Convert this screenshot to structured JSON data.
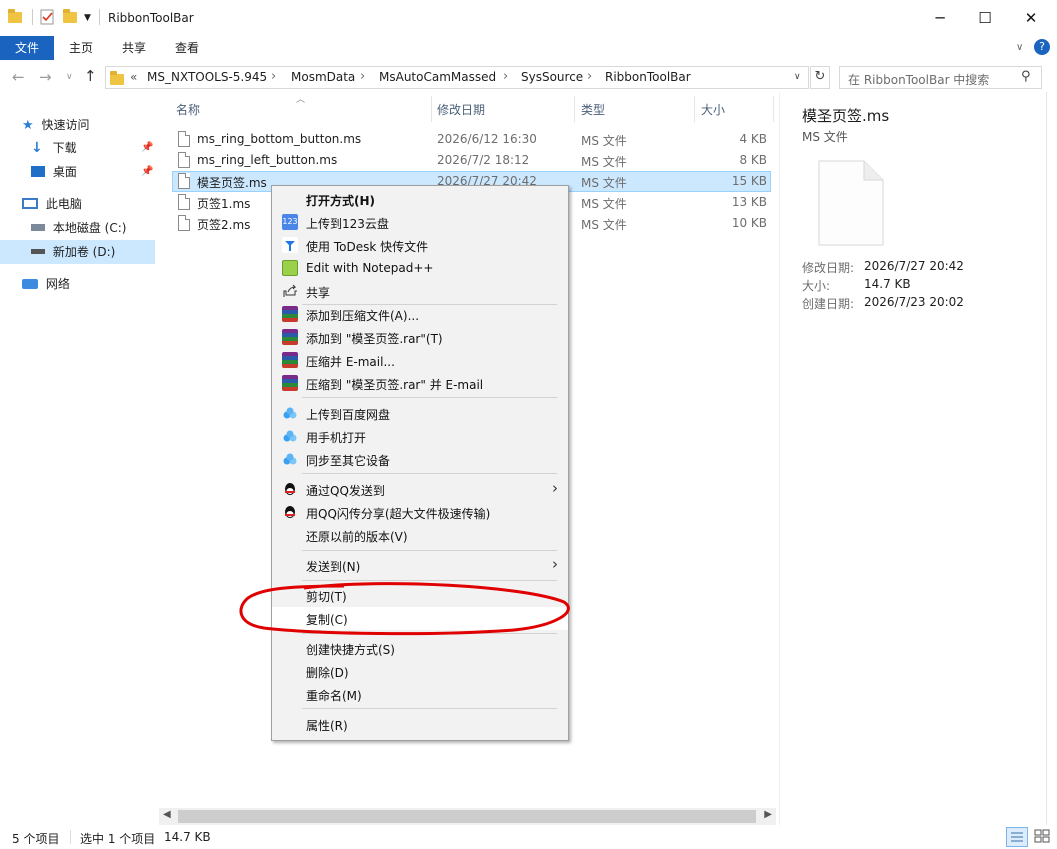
{
  "window": {
    "title": "RibbonToolBar",
    "minimize": "─",
    "maximize": "☐",
    "close": "✕"
  },
  "ribbon": {
    "tabs": [
      "文件",
      "主页",
      "共享",
      "查看"
    ],
    "help": "?"
  },
  "address": {
    "overflow": "«",
    "crumbs": [
      "MS_NXTOOLS-5.945",
      "MosmData",
      "MsAutoCamMassed",
      "SysSource",
      "RibbonToolBar"
    ],
    "search_placeholder": "在 RibbonToolBar 中搜索"
  },
  "nav": {
    "items": [
      "快速访问",
      "下载",
      "桌面",
      "此电脑",
      "本地磁盘 (C:)",
      "新加卷 (D:)",
      "网络"
    ]
  },
  "list": {
    "headers": {
      "name": "名称",
      "date": "修改日期",
      "type": "类型",
      "size": "大小"
    },
    "rows": [
      {
        "name": "ms_ring_bottom_button.ms",
        "date": "2026/6/12 16:30",
        "type": "MS 文件",
        "size": "4 KB"
      },
      {
        "name": "ms_ring_left_button.ms",
        "date": "2026/7/2 18:12",
        "type": "MS 文件",
        "size": "8 KB"
      },
      {
        "name": "模圣页签.ms",
        "date": "2026/7/27 20:42",
        "type": "MS 文件",
        "size": "15 KB"
      },
      {
        "name": "页签1.ms",
        "date": "",
        "type": "MS 文件",
        "size": "13 KB"
      },
      {
        "name": "页签2.ms",
        "date": "",
        "type": "MS 文件",
        "size": "10 KB"
      }
    ]
  },
  "context_menu": {
    "items": [
      "打开方式(H)",
      "上传到123云盘",
      "使用 ToDesk 快传文件",
      "Edit with Notepad++",
      "共享",
      "添加到压缩文件(A)...",
      "添加到 \"模圣页签.rar\"(T)",
      "压缩并 E-mail...",
      "压缩到 \"模圣页签.rar\" 并 E-mail",
      "上传到百度网盘",
      "用手机打开",
      "同步至其它设备",
      "通过QQ发送到",
      "用QQ闪传分享(超大文件极速传输)",
      "还原以前的版本(V)",
      "发送到(N)",
      "剪切(T)",
      "复制(C)",
      "创建快捷方式(S)",
      "删除(D)",
      "重命名(M)",
      "属性(R)"
    ],
    "icon_123": "123"
  },
  "details": {
    "filename": "模圣页签.ms",
    "filetype": "MS 文件",
    "labels": [
      "修改日期:",
      "大小:",
      "创建日期:"
    ],
    "values": [
      "2026/7/27 20:42",
      "14.7 KB",
      "2026/7/23 20:02"
    ]
  },
  "status": {
    "count": "5 个项目",
    "selected": "选中 1 个项目",
    "size": "14.7 KB"
  },
  "colors": {
    "accent": "#1a64c0",
    "selection": "#cce8ff",
    "annotation": "#e00000"
  }
}
